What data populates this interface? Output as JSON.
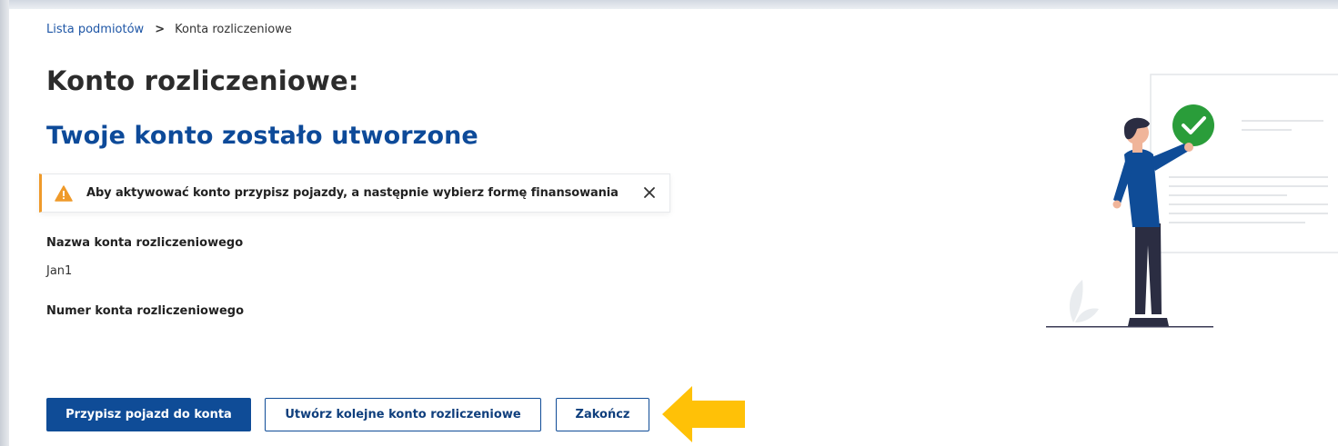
{
  "breadcrumb": {
    "link": "Lista podmiotów",
    "separator": ">",
    "current": "Konta rozliczeniowe"
  },
  "page": {
    "title": "Konto rozliczeniowe:",
    "subtitle": "Twoje konto zostało utworzone"
  },
  "alert": {
    "text": "Aby aktywować konto przypisz pojazdy, a następnie wybierz formę finansowania",
    "icon": "warning-icon",
    "close_icon": "close-icon",
    "color": "#ef9a2a"
  },
  "fields": {
    "name_label": "Nazwa konta rozliczeniowego",
    "name_value": "Jan1",
    "number_label": "Numer konta rozliczeniowego",
    "number_value": ""
  },
  "buttons": {
    "assign_vehicle": "Przypisz pojazd do konta",
    "create_another": "Utwórz kolejne konto rozliczeniowe",
    "finish": "Zakończ"
  },
  "colors": {
    "primary": "#0f4c97",
    "title_blue": "#0d4a99",
    "success_green": "#2a9d3a",
    "annotation_arrow": "#ffc107"
  }
}
